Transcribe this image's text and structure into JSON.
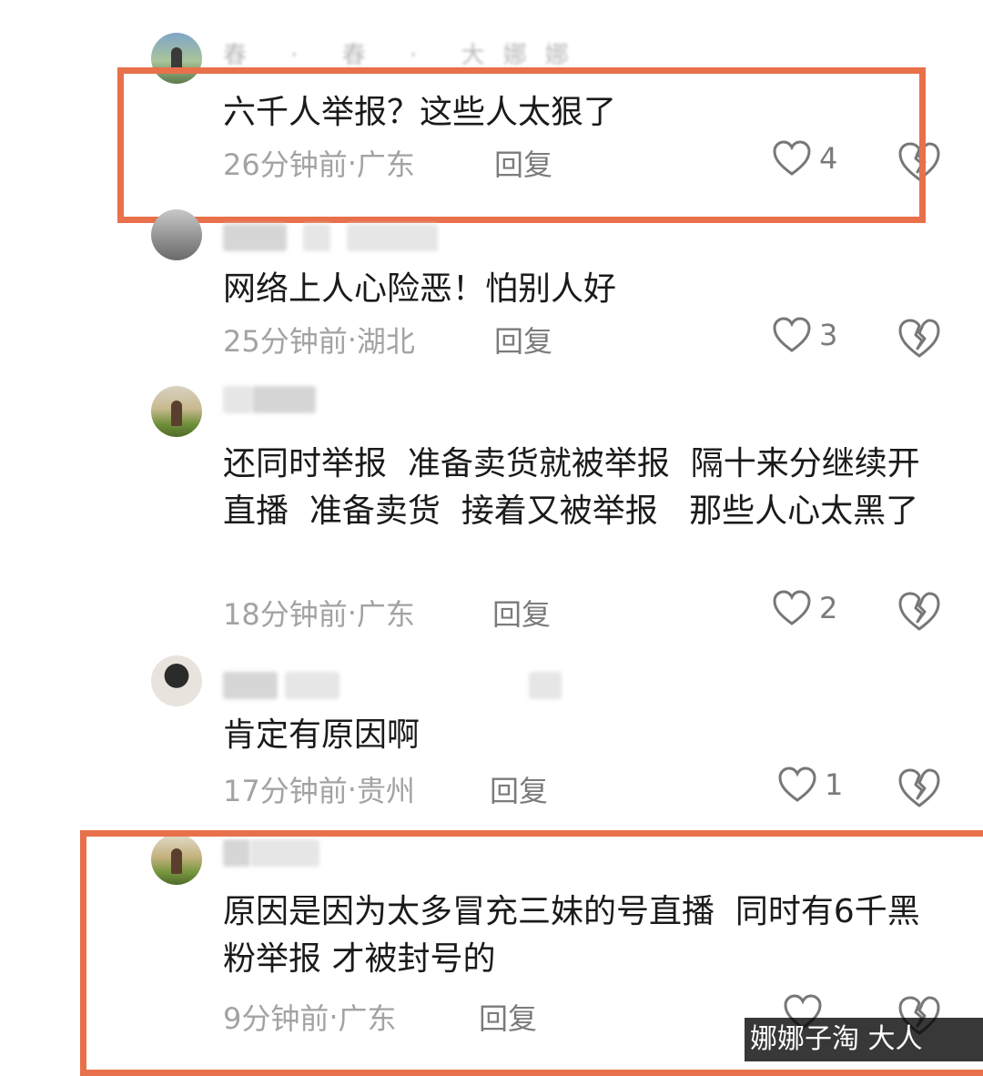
{
  "comments": [
    {
      "username": "春 · 春 · 大娜娜",
      "text": "六千人举报？这些人太狠了",
      "time": "26分钟前",
      "location": "广东",
      "reply_label": "回复",
      "likes": "4"
    },
    {
      "username": "",
      "text": "网络上人心险恶！怕别人好",
      "time": "25分钟前",
      "location": "湖北",
      "reply_label": "回复",
      "likes": "3"
    },
    {
      "username": "",
      "text": "还同时举报  准备卖货就被举报  隔十来分继续开直播  准备卖货  接着又被举报   那些人心太黑了",
      "time": "18分钟前",
      "location": "广东",
      "reply_label": "回复",
      "likes": "2"
    },
    {
      "username": "",
      "text": "肯定有原因啊",
      "time": "17分钟前",
      "location": "贵州",
      "reply_label": "回复",
      "likes": "1"
    },
    {
      "username": "",
      "text": "原因是因为太多冒充三妹的号直播  同时有6千黑粉举报 才被封号的",
      "time": "9分钟前",
      "location": "广东",
      "reply_label": "回复",
      "likes": ""
    }
  ],
  "separator": " · ",
  "watermark": "娜娜子淘 大人",
  "colors": {
    "highlight_border": "#e8704a",
    "text": "#1a1a1a",
    "meta": "#a3a3a3"
  },
  "icons": {
    "like": "heart-outline-icon",
    "dislike": "broken-heart-icon"
  }
}
